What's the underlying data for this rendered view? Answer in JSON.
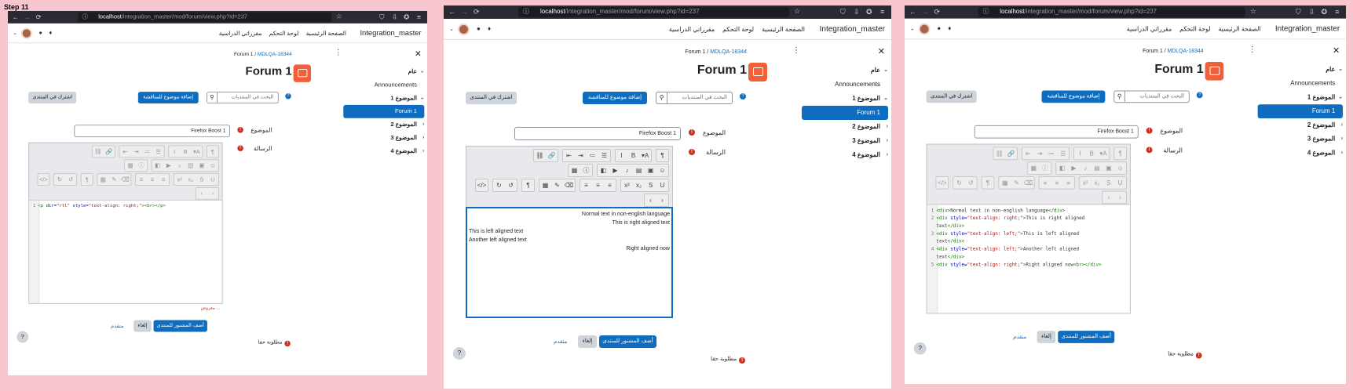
{
  "step_label": "Step 11",
  "browser": {
    "url_host": "localhost",
    "url_paths": [
      "/integration_master/mod/forum/view.php?id=237",
      "/integration_master/mod/forum/view.php?id=237",
      "/integration_master/mod/forum/view.php?id=237"
    ]
  },
  "topnav": {
    "brand": "Integration_master",
    "links": [
      "الصفحة الرئيسية",
      "لوحة التحكم",
      "مقرراتي الدراسية"
    ]
  },
  "drawer": {
    "items": [
      {
        "label": "عام",
        "bold": true,
        "chevron": "⌄"
      },
      {
        "label": "Announcements",
        "bold": false
      },
      {
        "label": "الموضوع 1",
        "bold": true,
        "chevron": "⌄"
      },
      {
        "label": "Forum 1",
        "active": true
      },
      {
        "label": "الموضوع 2",
        "bold": true,
        "chevron": "›"
      },
      {
        "label": "الموضوع 3",
        "bold": true,
        "chevron": "›"
      },
      {
        "label": "الموضوع 4",
        "bold": true,
        "chevron": "›"
      }
    ]
  },
  "breadcrumb": {
    "parent": "Forum 1",
    "current": "MDLQA-18344"
  },
  "page_title": "Forum 1",
  "actions": {
    "subscribe": "اشترك في المنتدى",
    "add_topic": "إضافة موضوع للمناقشة",
    "search_placeholder": "البحث في المنتديات"
  },
  "form": {
    "subject_label": "الموضوع",
    "message_label": "الرسالة",
    "subject_value": "Firefox Boost 1",
    "post_button": "أضف المشنور للمنتدى",
    "cancel_button": "إلغاء",
    "advanced_link": "متقدم",
    "required_note": "مطلوبة حقا",
    "char_counter": "معروض ..."
  },
  "shot1_code": [
    {
      "n": "1",
      "segs": [
        [
          "tg",
          "<p "
        ],
        [
          "at",
          "dir="
        ],
        [
          "st",
          "\"rtl\""
        ],
        [
          "at",
          " style="
        ],
        [
          "st",
          "\"text-align: right;\""
        ],
        [
          "tg",
          "><br></p>"
        ]
      ]
    }
  ],
  "shot2_wysiwyg": [
    {
      "text": "Normal text in non-english language",
      "align": "right"
    },
    {
      "text": "This is right aligned text",
      "align": "right"
    },
    {
      "text": "This is left aligned text",
      "align": "left"
    },
    {
      "text": "Another left aligned text",
      "align": "left"
    },
    {
      "text": "Right aligned now",
      "align": "right"
    }
  ],
  "shot3_code": [
    {
      "n": "1",
      "segs": [
        [
          "tg",
          "<div>"
        ],
        [
          "tx",
          "Normal text in non-english language"
        ],
        [
          "tg",
          "</div>"
        ]
      ]
    },
    {
      "n": "2",
      "segs": [
        [
          "tg",
          "<div "
        ],
        [
          "at",
          "style="
        ],
        [
          "st",
          "\"text-align: right;\""
        ],
        [
          "tg",
          ">"
        ],
        [
          "tx",
          "This is right aligned"
        ]
      ]
    },
    {
      "n": "",
      "segs": [
        [
          "tx",
          "text"
        ],
        [
          "tg",
          "</div>"
        ]
      ]
    },
    {
      "n": "3",
      "segs": [
        [
          "tg",
          "<div "
        ],
        [
          "at",
          "style="
        ],
        [
          "st",
          "\"text-align: left;\""
        ],
        [
          "tg",
          ">"
        ],
        [
          "tx",
          "This is left aligned"
        ]
      ]
    },
    {
      "n": "",
      "segs": [
        [
          "tx",
          "text"
        ],
        [
          "tg",
          "</div>"
        ]
      ]
    },
    {
      "n": "4",
      "segs": [
        [
          "tg",
          "<div "
        ],
        [
          "at",
          "style="
        ],
        [
          "st",
          "\"text-align: left;\""
        ],
        [
          "tg",
          ">"
        ],
        [
          "tx",
          "Another left aligned"
        ]
      ]
    },
    {
      "n": "",
      "segs": [
        [
          "tx",
          "text"
        ],
        [
          "tg",
          "</div>"
        ]
      ]
    },
    {
      "n": "5",
      "segs": [
        [
          "tg",
          "<div "
        ],
        [
          "at",
          "style="
        ],
        [
          "st",
          "\"text-align: right;\""
        ],
        [
          "tg",
          ">"
        ],
        [
          "tx",
          "Right aligned now"
        ],
        [
          "tg",
          "<br></div>"
        ]
      ]
    }
  ],
  "icons": {
    "nav": [
      "back-icon",
      "forward-icon",
      "reload-icon"
    ],
    "toolbar_row1": [
      "unlink-icon",
      "link-icon",
      "outdent-icon",
      "indent-icon",
      "numbered-list-icon",
      "bullet-list-icon",
      "italic-icon",
      "bold-icon",
      "font-size-icon",
      "rtl-icon"
    ],
    "toolbar_row2": [
      "table-grid-icon",
      "info-icon",
      "media-icon",
      "video-icon",
      "audio-icon",
      "file-icon",
      "image-icon",
      "emoji-icon"
    ],
    "toolbar_row3": [
      "source-code-icon",
      "redo-icon",
      "undo-icon",
      "ltr-icon",
      "table-icon",
      "edit-icon",
      "clear-icon",
      "align-right-icon",
      "align-center-icon",
      "align-left-icon",
      "superscript-icon",
      "subscript-icon",
      "strikethrough-icon",
      "underline-icon"
    ]
  },
  "colors": {
    "primary": "#0f6cbf",
    "danger": "#ca3120",
    "forum_icon": "#f0613a",
    "browser_bar": "#2b2a33"
  }
}
